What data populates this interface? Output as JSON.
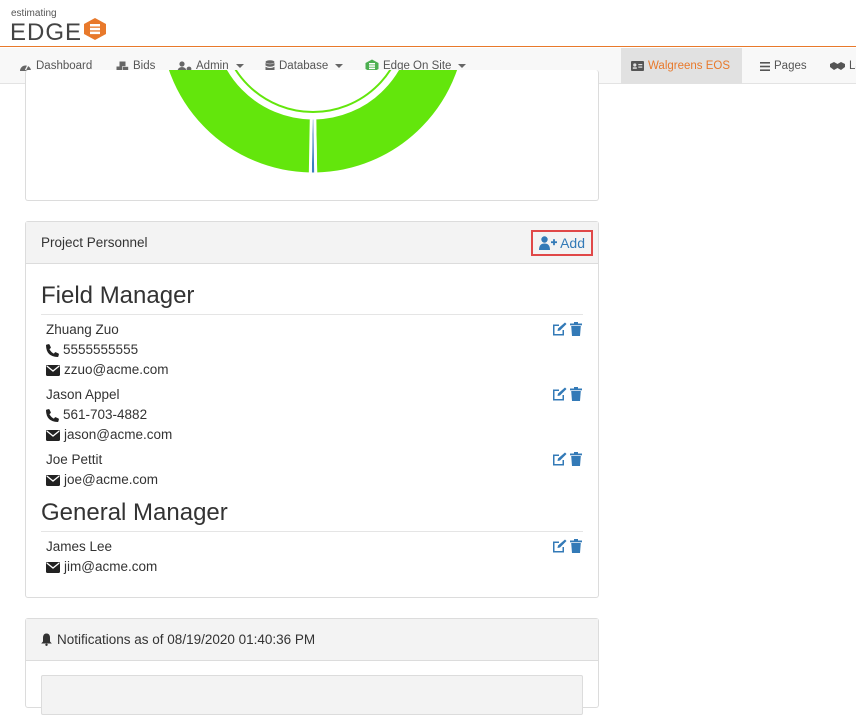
{
  "header": {
    "logo_small": "estimating",
    "logo_big": "EDGE",
    "brand_color": "#e8792b"
  },
  "nav": {
    "dashboard": "Dashboard",
    "bids": "Bids",
    "admin": "Admin",
    "database": "Database",
    "edge_on_site": "Edge On Site",
    "walgreens": "Walgreens EOS",
    "pages": "Pages",
    "overflow": "La"
  },
  "chart": {
    "type": "pie",
    "colors": [
      "#63e60c",
      "#3a7fc0"
    ]
  },
  "personnel": {
    "title": "Project Personnel",
    "add_label": "Add",
    "sections": [
      {
        "title": "Field Manager",
        "people": [
          {
            "name": "Zhuang Zuo",
            "phone": "5555555555",
            "email": "zzuo@acme.com"
          },
          {
            "name": "Jason Appel",
            "phone": "561-703-4882",
            "email": "jason@acme.com"
          },
          {
            "name": "Joe Pettit",
            "email": "joe@acme.com"
          }
        ]
      },
      {
        "title": "General Manager",
        "people": [
          {
            "name": "James Lee",
            "email": "jim@acme.com"
          }
        ]
      }
    ]
  },
  "notifications": {
    "title": "Notifications as of 08/19/2020 01:40:36 PM"
  }
}
